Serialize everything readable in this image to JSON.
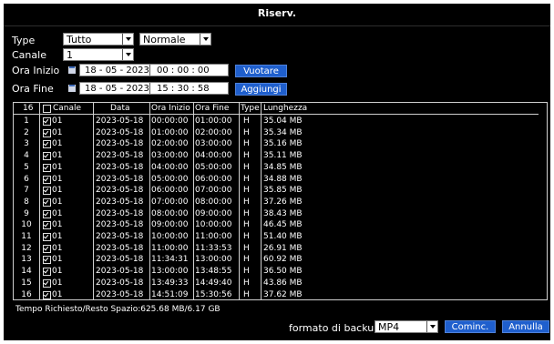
{
  "window": {
    "title": "Riserv."
  },
  "filters": {
    "type_label": "Type",
    "type_value": "Tutto",
    "mode_value": "Normale",
    "canale_label": "Canale",
    "canale_value": "1",
    "ora_inizio_label": "Ora Inizio",
    "ora_inizio_date": "18 - 05 - 2023",
    "ora_inizio_time": "00 : 00 : 00",
    "ora_fine_label": "Ora Fine",
    "ora_fine_date": "18 - 05 - 2023",
    "ora_fine_time": "15 : 30 : 58",
    "vuotare_label": "Vuotare",
    "aggiungi_label": "Aggiungi"
  },
  "table": {
    "count": "16",
    "headers": {
      "canale": "Canale",
      "data": "Data",
      "ora_inizio": "Ora Inizio",
      "ora_fine": "Ora Fine",
      "type": "Type",
      "lunghezza": "Lunghezza"
    },
    "rows": [
      {
        "n": "1",
        "canale": "01",
        "data": "2023-05-18",
        "inizio": "00:00:00",
        "fine": "01:00:00",
        "type": "H",
        "size": "35.04 MB"
      },
      {
        "n": "2",
        "canale": "01",
        "data": "2023-05-18",
        "inizio": "01:00:00",
        "fine": "02:00:00",
        "type": "H",
        "size": "35.34 MB"
      },
      {
        "n": "3",
        "canale": "01",
        "data": "2023-05-18",
        "inizio": "02:00:00",
        "fine": "03:00:00",
        "type": "H",
        "size": "35.16 MB"
      },
      {
        "n": "4",
        "canale": "01",
        "data": "2023-05-18",
        "inizio": "03:00:00",
        "fine": "04:00:00",
        "type": "H",
        "size": "35.11 MB"
      },
      {
        "n": "5",
        "canale": "01",
        "data": "2023-05-18",
        "inizio": "04:00:00",
        "fine": "05:00:00",
        "type": "H",
        "size": "34.85 MB"
      },
      {
        "n": "6",
        "canale": "01",
        "data": "2023-05-18",
        "inizio": "05:00:00",
        "fine": "06:00:00",
        "type": "H",
        "size": "34.88 MB"
      },
      {
        "n": "7",
        "canale": "01",
        "data": "2023-05-18",
        "inizio": "06:00:00",
        "fine": "07:00:00",
        "type": "H",
        "size": "35.85 MB"
      },
      {
        "n": "8",
        "canale": "01",
        "data": "2023-05-18",
        "inizio": "07:00:00",
        "fine": "08:00:00",
        "type": "H",
        "size": "37.26 MB"
      },
      {
        "n": "9",
        "canale": "01",
        "data": "2023-05-18",
        "inizio": "08:00:00",
        "fine": "09:00:00",
        "type": "H",
        "size": "38.43 MB"
      },
      {
        "n": "10",
        "canale": "01",
        "data": "2023-05-18",
        "inizio": "09:00:00",
        "fine": "10:00:00",
        "type": "H",
        "size": "46.45 MB"
      },
      {
        "n": "11",
        "canale": "01",
        "data": "2023-05-18",
        "inizio": "10:00:00",
        "fine": "11:00:00",
        "type": "H",
        "size": "51.40 MB"
      },
      {
        "n": "12",
        "canale": "01",
        "data": "2023-05-18",
        "inizio": "11:00:00",
        "fine": "11:33:53",
        "type": "H",
        "size": "26.91 MB"
      },
      {
        "n": "13",
        "canale": "01",
        "data": "2023-05-18",
        "inizio": "11:34:31",
        "fine": "13:00:00",
        "type": "H",
        "size": "60.92 MB"
      },
      {
        "n": "14",
        "canale": "01",
        "data": "2023-05-18",
        "inizio": "13:00:00",
        "fine": "13:48:55",
        "type": "H",
        "size": "36.50 MB"
      },
      {
        "n": "15",
        "canale": "01",
        "data": "2023-05-18",
        "inizio": "13:49:33",
        "fine": "14:49:40",
        "type": "H",
        "size": "43.86 MB"
      },
      {
        "n": "16",
        "canale": "01",
        "data": "2023-05-18",
        "inizio": "14:51:09",
        "fine": "15:30:56",
        "type": "H",
        "size": "37.62 MB"
      }
    ]
  },
  "status": {
    "text": "Tempo Richiesto/Resto Spazio:625.68 MB/6.17 GB"
  },
  "footer": {
    "format_label": "formato di backup",
    "format_value": "MP4",
    "start_label": "Cominc.",
    "cancel_label": "Annulla"
  },
  "colors": {
    "button": "#1f5fcd",
    "background": "#000000"
  }
}
